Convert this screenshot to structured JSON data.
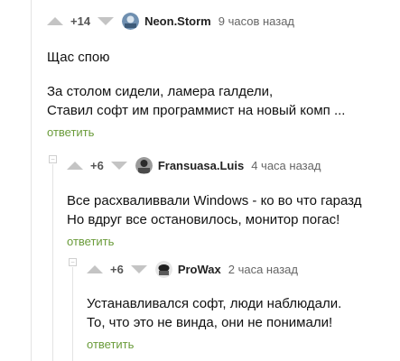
{
  "accent": "#6a9b3a",
  "icons": {
    "upvote": "triangle-up",
    "downvote": "triangle-down",
    "collapse": "minus-box"
  },
  "comments": [
    {
      "rating": "+14",
      "author": "Neon.Storm",
      "time": "9 часов назад",
      "lines": [
        "Щас спою",
        "",
        "За столом сидели, ламера галдели,",
        "Ставил софт им программист на новый комп ..."
      ],
      "reply_label": "ответить"
    },
    {
      "rating": "+6",
      "author": "Fransuasa.Luis",
      "time": "4 часа назад",
      "lines": [
        "Все расхваливвали Windows - ко во что гаразд",
        "Но вдруг все остановилось, монитор погас!"
      ],
      "reply_label": "ответить"
    },
    {
      "rating": "+6",
      "author": "ProWax",
      "time": "2 часа назад",
      "lines": [
        "Устанавливался софт, люди наблюдали.",
        "То, что это не винда, они не понимали!"
      ],
      "reply_label": "ответить"
    }
  ]
}
